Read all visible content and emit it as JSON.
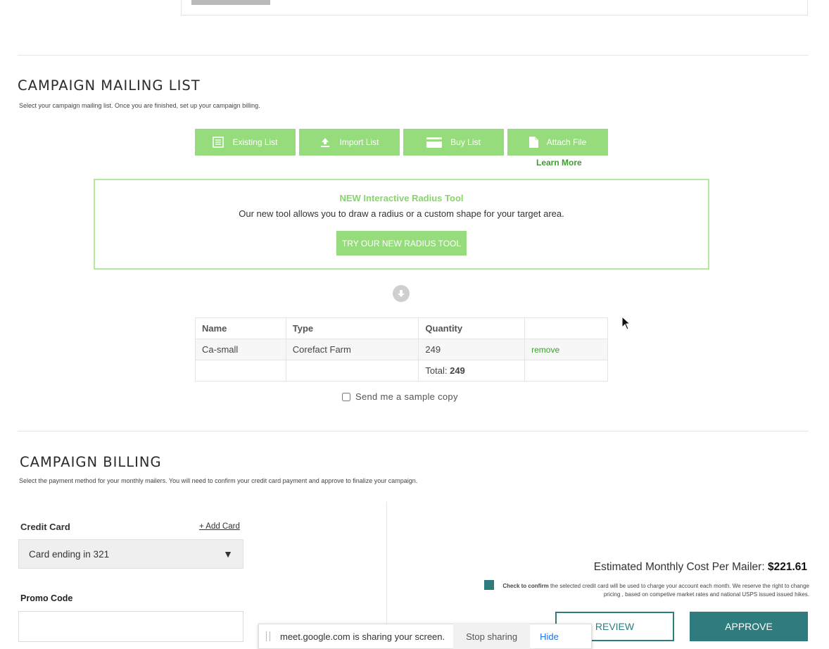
{
  "mailing_section": {
    "title": "CAMPAIGN MAILING LIST",
    "subtitle": "Select your campaign mailing list. Once you are finished, set up your campaign billing."
  },
  "list_buttons": [
    {
      "label": "Existing List",
      "icon": "list-icon"
    },
    {
      "label": "Import List",
      "icon": "upload-icon"
    },
    {
      "label": "Buy List",
      "icon": "credit-card-icon"
    },
    {
      "label": "Attach File",
      "icon": "file-icon"
    }
  ],
  "learn_more": "Learn More",
  "radius_promo": {
    "title": "NEW Interactive Radius Tool",
    "description": "Our new tool allows you to draw a radius or a custom shape for your target area.",
    "button": "TRY OUR NEW RADIUS TOOL"
  },
  "mailing_table": {
    "headers": [
      "Name",
      "Type",
      "Quantity",
      ""
    ],
    "rows": [
      {
        "name": "Ca-small",
        "type": "Corefact Farm",
        "quantity": "249",
        "action": "remove"
      }
    ],
    "total_label": "Total:",
    "total_value": "249"
  },
  "sample_copy": "Send me a sample copy",
  "billing_section": {
    "title": "CAMPAIGN BILLING",
    "subtitle": "Select the payment method for your monthly mailers. You will need to confirm your credit card payment and approve to finalize your campaign."
  },
  "billing": {
    "credit_card_label": "Credit Card",
    "add_card": "+ Add Card",
    "card_selected": "Card ending in 321",
    "promo_label": "Promo Code",
    "promo_value": "",
    "estimate_label": "Estimated Monthly Cost Per Mailer:",
    "estimate_value": "$221.61",
    "confirm_bold": "Check to confirm",
    "confirm_text": " the selected credit card will be used to charge your account each month.  We reserve the right to change pricing , based on competive market rates and national USPS issued issued hikes.",
    "review": "REVIEW",
    "approve": "APPROVE"
  },
  "share_bar": {
    "message": "meet.google.com is sharing your screen.",
    "stop": "Stop sharing",
    "hide": "Hide"
  },
  "colors": {
    "green_button": "#96dc7c",
    "green_link": "#3aa02b",
    "teal": "#2f7c7e"
  }
}
